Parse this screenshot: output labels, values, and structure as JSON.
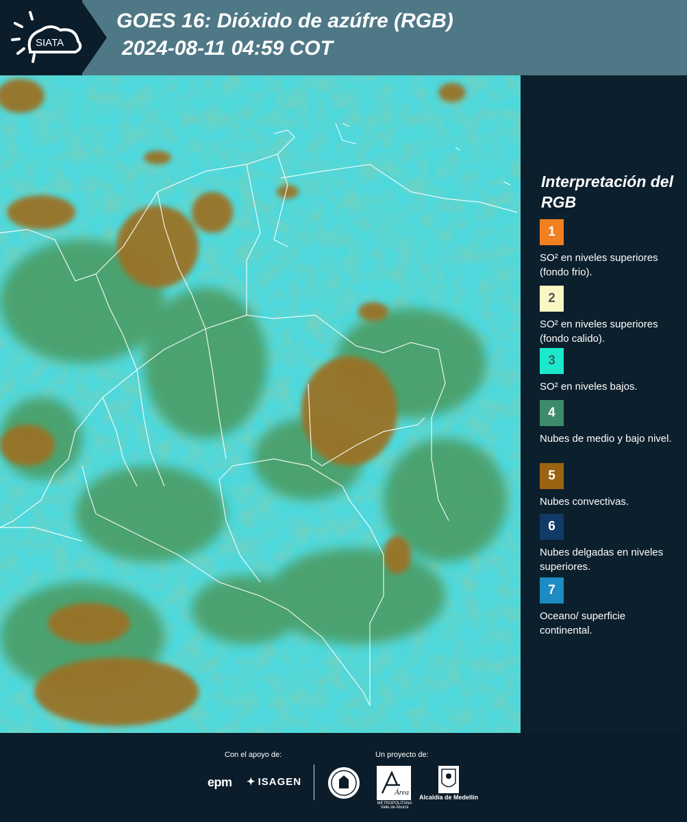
{
  "header": {
    "logo_text": "SIATA",
    "title_line1": "GOES 16: Dióxido de azúfre (RGB)",
    "title_line2": "2024-08-11 04:59 COT"
  },
  "legend": {
    "title": "Interpretación del RGB",
    "items": [
      {
        "num": "1",
        "color": "#f08020",
        "text": "SO² en niveles superiores (fondo frio)."
      },
      {
        "num": "2",
        "color": "#fbf7c4",
        "text": "SO² en niveles superiores (fondo calido)."
      },
      {
        "num": "3",
        "color": "#1de8cc",
        "text": "SO² en niveles bajos."
      },
      {
        "num": "4",
        "color": "#3e8b6c",
        "text": "Nubes de medio y bajo nivel."
      },
      {
        "num": "5",
        "color": "#9a6312",
        "text": "Nubes convectivas."
      },
      {
        "num": "6",
        "color": "#123a66",
        "text": "Nubes delgadas en niveles superiores."
      },
      {
        "num": "7",
        "color": "#1d8cc4",
        "text": "Oceano/ superficie continental."
      }
    ]
  },
  "map": {
    "colors": {
      "cyan": "#4fd8dc",
      "green": "#4a9a5e",
      "brown": "#9a7228",
      "border": "#ffffff"
    }
  },
  "footer": {
    "support_label": "Con el apoyo de:",
    "project_label": "Un proyecto de:",
    "epm": "epm",
    "isagen": "ISAGEN",
    "area_label": "METROPOLITANA Valle de Aburrá",
    "area_word": "Área",
    "alcaldia": "Alcaldía de Medellín"
  }
}
